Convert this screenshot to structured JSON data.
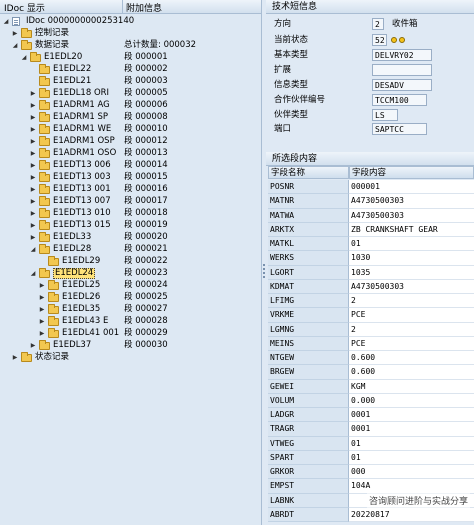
{
  "tree": {
    "header_col1": "IDoc 显示",
    "header_col2": "附加信息",
    "rows": [
      {
        "level": 0,
        "arrow": "expanded",
        "icon": "doc-icon",
        "label": "IDoc 0000000000253140",
        "info": ""
      },
      {
        "level": 1,
        "arrow": "collapsed",
        "icon": "folder-icon",
        "label": "控制记录",
        "info": ""
      },
      {
        "level": 1,
        "arrow": "expanded",
        "icon": "folder-icon",
        "label": "数据记录",
        "info": "总计数量:        000032"
      },
      {
        "level": 2,
        "arrow": "expanded",
        "icon": "folder-icon",
        "label": "E1EDL20",
        "info": "段 000001"
      },
      {
        "level": 3,
        "arrow": "none",
        "icon": "folder-icon",
        "label": "E1EDL22",
        "info": "段 000002"
      },
      {
        "level": 3,
        "arrow": "none",
        "icon": "folder-icon",
        "label": "E1EDL21",
        "info": "段 000003"
      },
      {
        "level": 3,
        "arrow": "collapsed",
        "icon": "folder-icon",
        "label": "E1EDL18 ORI",
        "info": "段 000005"
      },
      {
        "level": 3,
        "arrow": "collapsed",
        "icon": "folder-icon",
        "label": "E1ADRM1 AG",
        "info": "段 000006"
      },
      {
        "level": 3,
        "arrow": "collapsed",
        "icon": "folder-icon",
        "label": "E1ADRM1 SP",
        "info": "段 000008"
      },
      {
        "level": 3,
        "arrow": "collapsed",
        "icon": "folder-icon",
        "label": "E1ADRM1 WE",
        "info": "段 000010"
      },
      {
        "level": 3,
        "arrow": "collapsed",
        "icon": "folder-icon",
        "label": "E1ADRM1 OSP",
        "info": "段 000012"
      },
      {
        "level": 3,
        "arrow": "collapsed",
        "icon": "folder-icon",
        "label": "E1ADRM1 OSO",
        "info": "段 000013"
      },
      {
        "level": 3,
        "arrow": "collapsed",
        "icon": "folder-icon",
        "label": "E1EDT13 006",
        "info": "段 000014"
      },
      {
        "level": 3,
        "arrow": "collapsed",
        "icon": "folder-icon",
        "label": "E1EDT13 003",
        "info": "段 000015"
      },
      {
        "level": 3,
        "arrow": "collapsed",
        "icon": "folder-icon",
        "label": "E1EDT13 001",
        "info": "段 000016"
      },
      {
        "level": 3,
        "arrow": "collapsed",
        "icon": "folder-icon",
        "label": "E1EDT13 007",
        "info": "段 000017"
      },
      {
        "level": 3,
        "arrow": "collapsed",
        "icon": "folder-icon",
        "label": "E1EDT13 010",
        "info": "段 000018"
      },
      {
        "level": 3,
        "arrow": "collapsed",
        "icon": "folder-icon",
        "label": "E1EDT13 015",
        "info": "段 000019"
      },
      {
        "level": 3,
        "arrow": "collapsed",
        "icon": "folder-icon",
        "label": "E1EDL33",
        "info": "段 000020"
      },
      {
        "level": 3,
        "arrow": "expanded",
        "icon": "folder-icon",
        "label": "E1EDL28",
        "info": "段 000021"
      },
      {
        "level": 4,
        "arrow": "none",
        "icon": "folder-icon",
        "label": "E1EDL29",
        "info": "段 000022"
      },
      {
        "level": 3,
        "arrow": "expanded",
        "icon": "folder-icon",
        "label": "E1EDL24",
        "info": "段 000023",
        "selected": true
      },
      {
        "level": 4,
        "arrow": "collapsed",
        "icon": "folder-icon",
        "label": "E1EDL25",
        "info": "段 000024"
      },
      {
        "level": 4,
        "arrow": "collapsed",
        "icon": "folder-icon",
        "label": "E1EDL26",
        "info": "段 000025"
      },
      {
        "level": 4,
        "arrow": "collapsed",
        "icon": "folder-icon",
        "label": "E1EDL35",
        "info": "段 000027"
      },
      {
        "level": 4,
        "arrow": "collapsed",
        "icon": "folder-icon",
        "label": "E1EDL43 E",
        "info": "段 000028"
      },
      {
        "level": 4,
        "arrow": "collapsed",
        "icon": "folder-icon",
        "label": "E1EDL41 001",
        "info": "段 000029"
      },
      {
        "level": 3,
        "arrow": "collapsed",
        "icon": "folder-icon",
        "label": "E1EDL37",
        "info": "段 000030"
      },
      {
        "level": 1,
        "arrow": "collapsed",
        "icon": "folder-icon",
        "label": "状态记录",
        "info": ""
      }
    ]
  },
  "tech": {
    "title": "技术短信息",
    "direction_label": "方向",
    "direction_value": "2",
    "direction_text": "收件箱",
    "status_label": "当前状态",
    "status_value": "52",
    "basic_type_label": "基本类型",
    "basic_type_value": "DELVRY02",
    "extension_label": "扩展",
    "extension_value": "",
    "message_type_label": "信息类型",
    "message_type_value": "DESADV",
    "partner_no_label": "合作伙伴编号",
    "partner_no_value": "TCCM100",
    "partner_type_label": "伙伴类型",
    "partner_type_value": "LS",
    "port_label": "端口",
    "port_value": "SAPTCC"
  },
  "segment": {
    "title": "所选段内容",
    "col1": "字段名称",
    "col2": "字段内容",
    "rows": [
      {
        "name": "POSNR",
        "value": "000001"
      },
      {
        "name": "MATNR",
        "value": "A4730500303"
      },
      {
        "name": "MATWA",
        "value": "A4730500303"
      },
      {
        "name": "ARKTX",
        "value": "ZB CRANKSHAFT GEAR"
      },
      {
        "name": "MATKL",
        "value": "01"
      },
      {
        "name": "WERKS",
        "value": "1030"
      },
      {
        "name": "LGORT",
        "value": "1035"
      },
      {
        "name": "KDMAT",
        "value": "A4730500303"
      },
      {
        "name": "LFIMG",
        "value": "2"
      },
      {
        "name": "VRKME",
        "value": "PCE"
      },
      {
        "name": "LGMNG",
        "value": "2"
      },
      {
        "name": "MEINS",
        "value": "PCE"
      },
      {
        "name": "NTGEW",
        "value": "0.600"
      },
      {
        "name": "BRGEW",
        "value": "0.600"
      },
      {
        "name": "GEWEI",
        "value": "KGM"
      },
      {
        "name": "VOLUM",
        "value": "0.000"
      },
      {
        "name": "LADGR",
        "value": "0001"
      },
      {
        "name": "TRAGR",
        "value": "0001"
      },
      {
        "name": "VTWEG",
        "value": "01"
      },
      {
        "name": "SPART",
        "value": "01"
      },
      {
        "name": "GRKOR",
        "value": "000"
      },
      {
        "name": "EMPST",
        "value": "104A"
      },
      {
        "name": "LABNK",
        "value": ""
      },
      {
        "name": "ABRDT",
        "value": "20220817"
      }
    ]
  },
  "watermark": "咨询顾问进阶与实战分享"
}
